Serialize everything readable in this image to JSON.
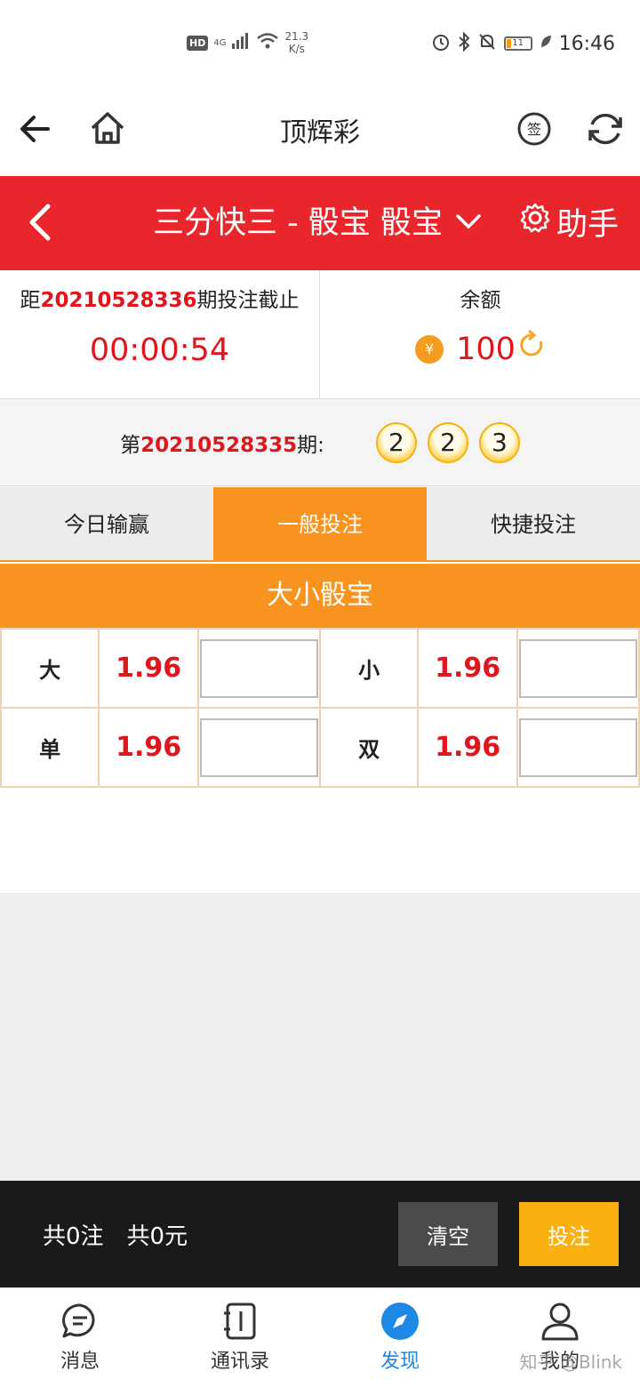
{
  "status_bar": {
    "network": "4G",
    "hd": "HD",
    "speed_value": "21.3",
    "speed_unit": "K/s",
    "battery": "11",
    "time": "16:46"
  },
  "app_header": {
    "title": "顶辉彩",
    "icons": [
      "back-arrow-icon",
      "home-icon",
      "sign-in-icon",
      "refresh-icon"
    ]
  },
  "game_header": {
    "title": "三分快三 - 骰宝 骰宝",
    "helper_label": "助手"
  },
  "countdown": {
    "prefix": "距",
    "period": "20210528336",
    "suffix": "期投注截止",
    "time_left": "00:00:54"
  },
  "balance": {
    "label": "余额",
    "currency_icon": "¥",
    "amount": "100"
  },
  "last_result": {
    "prefix": "第",
    "period": "20210528335",
    "suffix": "期:",
    "dice": [
      "2",
      "2",
      "3"
    ]
  },
  "tabs": [
    {
      "label": "今日输赢",
      "active": false
    },
    {
      "label": "一般投注",
      "active": true
    },
    {
      "label": "快捷投注",
      "active": false
    }
  ],
  "section_title": "大小骰宝",
  "bets": [
    [
      {
        "name": "大",
        "odds": "1.96"
      },
      {
        "name": "小",
        "odds": "1.96"
      }
    ],
    [
      {
        "name": "单",
        "odds": "1.96"
      },
      {
        "name": "双",
        "odds": "1.96"
      }
    ]
  ],
  "bet_bar": {
    "count_text": "共0注",
    "amount_text": "共0元",
    "clear_label": "清空",
    "submit_label": "投注"
  },
  "bottom_nav": [
    {
      "label": "消息",
      "icon": "message-icon",
      "active": false
    },
    {
      "label": "通讯录",
      "icon": "contacts-icon",
      "active": false
    },
    {
      "label": "发现",
      "icon": "compass-icon",
      "active": true
    },
    {
      "label": "我的",
      "icon": "profile-icon",
      "active": false
    }
  ],
  "watermark": "知乎 @Blink",
  "colors": {
    "red": "#e8262c",
    "orange": "#f7931e",
    "yellow_button": "#fbb012",
    "nav_active": "#1e88e5"
  }
}
